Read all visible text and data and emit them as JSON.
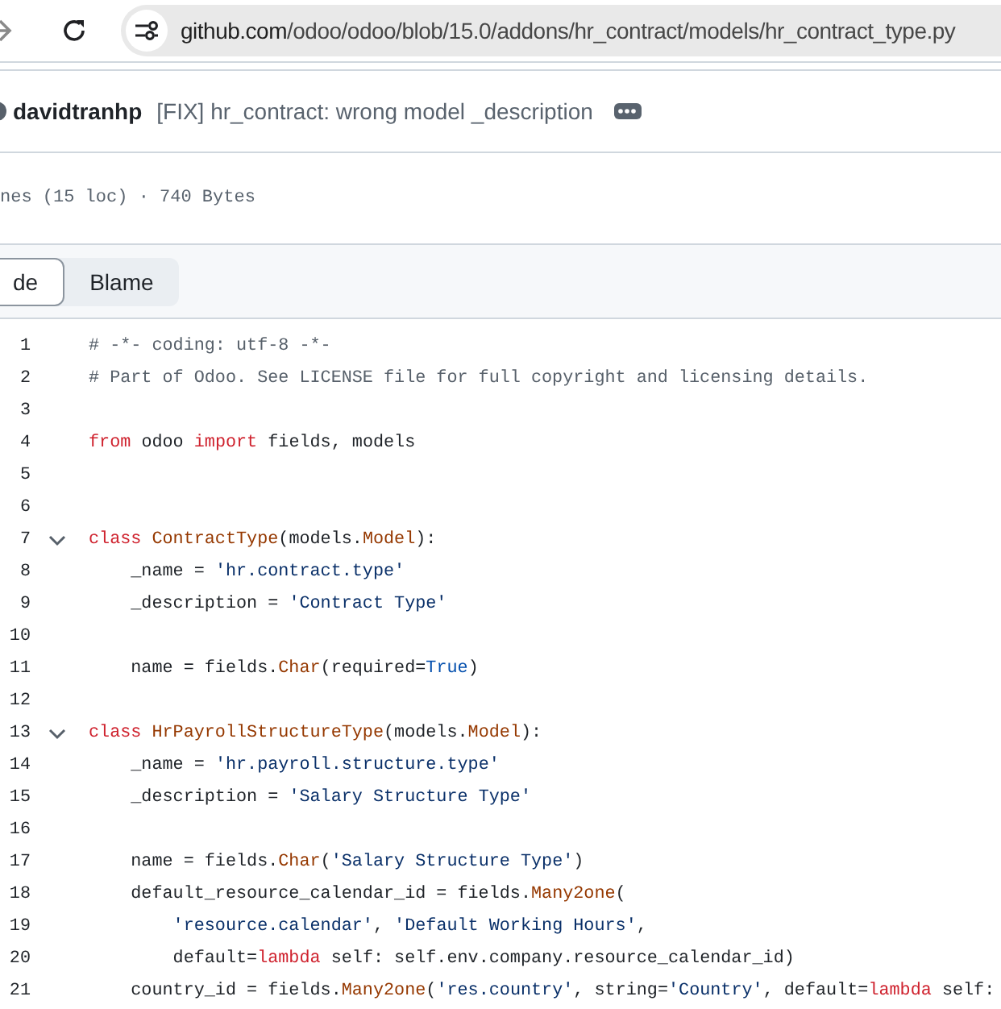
{
  "browser": {
    "url": {
      "host": "github.com",
      "path": "/odoo/odoo/blob/15.0/addons/hr_contract/models/hr_contract_type.py"
    }
  },
  "commit": {
    "author": "davidtranhp",
    "message": "[FIX] hr_contract: wrong model _description"
  },
  "file_info": "nes (15 loc) · 740 Bytes",
  "tabs": [
    {
      "label": "de",
      "selected": true
    },
    {
      "label": "Blame",
      "selected": false
    }
  ],
  "code": [
    {
      "number": "1",
      "foldable": false,
      "tokens": [
        {
          "kind": "comment",
          "text": "# -*- coding: utf-8 -*-"
        }
      ]
    },
    {
      "number": "2",
      "foldable": false,
      "tokens": [
        {
          "kind": "comment",
          "text": "# Part of Odoo. See LICENSE file for full copyright and licensing details."
        }
      ]
    },
    {
      "number": "3",
      "foldable": false
    },
    {
      "number": "4",
      "foldable": false,
      "tokens": [
        {
          "kind": "keyword",
          "text": "from"
        },
        {
          "kind": "plain",
          "text": " odoo "
        },
        {
          "kind": "keyword",
          "text": "import"
        },
        {
          "kind": "plain",
          "text": " fields, models"
        }
      ]
    },
    {
      "number": "5",
      "foldable": false
    },
    {
      "number": "6",
      "foldable": false
    },
    {
      "number": "7",
      "foldable": true,
      "tokens": [
        {
          "kind": "keyword",
          "text": "class "
        },
        {
          "kind": "name",
          "text": "ContractType"
        },
        {
          "kind": "plain",
          "text": "(models."
        },
        {
          "kind": "name",
          "text": "Model"
        },
        {
          "kind": "plain",
          "text": "):"
        }
      ]
    },
    {
      "number": "8",
      "foldable": false,
      "tokens": [
        {
          "kind": "plain",
          "text": "    _name = "
        },
        {
          "kind": "string",
          "text": "'hr.contract.type'"
        }
      ]
    },
    {
      "number": "9",
      "foldable": false,
      "tokens": [
        {
          "kind": "plain",
          "text": "    _description = "
        },
        {
          "kind": "string",
          "text": "'Contract Type'"
        }
      ]
    },
    {
      "number": "10",
      "foldable": false
    },
    {
      "number": "11",
      "foldable": false,
      "tokens": [
        {
          "kind": "plain",
          "text": "    name = fields."
        },
        {
          "kind": "name",
          "text": "Char"
        },
        {
          "kind": "plain",
          "text": "(required="
        },
        {
          "kind": "constant",
          "text": "True"
        },
        {
          "kind": "plain",
          "text": ")"
        }
      ]
    },
    {
      "number": "12",
      "foldable": false
    },
    {
      "number": "13",
      "foldable": true,
      "tokens": [
        {
          "kind": "keyword",
          "text": "class "
        },
        {
          "kind": "name",
          "text": "HrPayrollStructureType"
        },
        {
          "kind": "plain",
          "text": "(models."
        },
        {
          "kind": "name",
          "text": "Model"
        },
        {
          "kind": "plain",
          "text": "):"
        }
      ]
    },
    {
      "number": "14",
      "foldable": false,
      "tokens": [
        {
          "kind": "plain",
          "text": "    _name = "
        },
        {
          "kind": "string",
          "text": "'hr.payroll.structure.type'"
        }
      ]
    },
    {
      "number": "15",
      "foldable": false,
      "tokens": [
        {
          "kind": "plain",
          "text": "    _description = "
        },
        {
          "kind": "string",
          "text": "'Salary Structure Type'"
        }
      ]
    },
    {
      "number": "16",
      "foldable": false
    },
    {
      "number": "17",
      "foldable": false,
      "tokens": [
        {
          "kind": "plain",
          "text": "    name = fields."
        },
        {
          "kind": "name",
          "text": "Char"
        },
        {
          "kind": "plain",
          "text": "("
        },
        {
          "kind": "string",
          "text": "'Salary Structure Type'"
        },
        {
          "kind": "plain",
          "text": ")"
        }
      ]
    },
    {
      "number": "18",
      "foldable": false,
      "tokens": [
        {
          "kind": "plain",
          "text": "    default_resource_calendar_id = fields."
        },
        {
          "kind": "name",
          "text": "Many2one"
        },
        {
          "kind": "plain",
          "text": "("
        }
      ]
    },
    {
      "number": "19",
      "foldable": false,
      "tokens": [
        {
          "kind": "string",
          "text": "        'resource.calendar'"
        },
        {
          "kind": "plain",
          "text": ", "
        },
        {
          "kind": "string",
          "text": "'Default Working Hours'"
        },
        {
          "kind": "plain",
          "text": ","
        }
      ]
    },
    {
      "number": "20",
      "foldable": false,
      "tokens": [
        {
          "kind": "plain",
          "text": "        default="
        },
        {
          "kind": "keyword",
          "text": "lambda"
        },
        {
          "kind": "plain",
          "text": " self: self.env.company.resource_calendar_id)"
        }
      ]
    },
    {
      "number": "21",
      "foldable": false,
      "tokens": [
        {
          "kind": "plain",
          "text": "    country_id = fields."
        },
        {
          "kind": "name",
          "text": "Many2one"
        },
        {
          "kind": "plain",
          "text": "("
        },
        {
          "kind": "string",
          "text": "'res.country'"
        },
        {
          "kind": "plain",
          "text": ", string="
        },
        {
          "kind": "string",
          "text": "'Country'"
        },
        {
          "kind": "plain",
          "text": ", default="
        },
        {
          "kind": "keyword",
          "text": "lambda"
        },
        {
          "kind": "plain",
          "text": " self:"
        }
      ]
    }
  ]
}
